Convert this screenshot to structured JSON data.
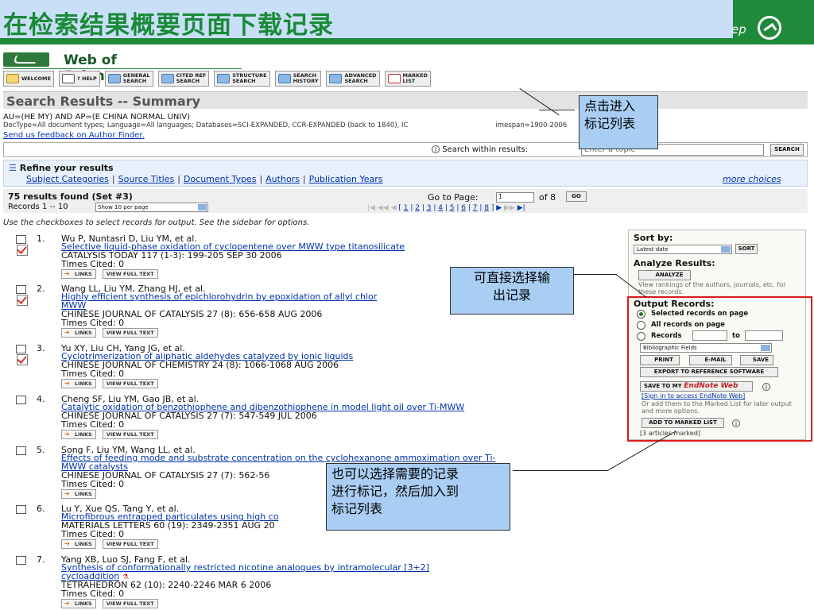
{
  "slide": {
    "title": "在检索结果概要页面下载记录",
    "step_text": "ep"
  },
  "app": {
    "title": "Web of Science",
    "registered": "®"
  },
  "toolbar": [
    {
      "label": "WELCOME",
      "icon": "home-icon"
    },
    {
      "label": "? HELP",
      "icon": "help-icon"
    },
    {
      "label": "GENERAL\nSEARCH",
      "icon": "general-search-icon"
    },
    {
      "label": "CITED REF\nSEARCH",
      "icon": "cited-ref-icon"
    },
    {
      "label": "STRUCTURE\nSEARCH",
      "icon": "structure-icon"
    },
    {
      "label": "SEARCH\nHISTORY",
      "icon": "history-icon"
    },
    {
      "label": "ADVANCED\nSEARCH",
      "icon": "advanced-icon"
    },
    {
      "label": "MARKED\nLIST",
      "icon": "marked-list-icon"
    }
  ],
  "summary": {
    "title": "Search Results -- Summary",
    "query": "AU=(HE MY) AND AP=(E CHINA NORMAL UNIV)",
    "meta": "DocType=All document types; Language=All languages; Databases=SCI-EXPANDED, CCR-EXPANDED (back to 1840), IC",
    "meta_end": "imespan=1900-2006",
    "feedback": "Send us feedback on Author Finder."
  },
  "search": {
    "label": "Search within results:",
    "placeholder": "Enter a topic",
    "button": "SEARCH"
  },
  "refine": {
    "title": "Refine your results",
    "links": [
      "Subject Categories",
      "Source Titles",
      "Document Types",
      "Authors",
      "Publication Years"
    ],
    "more": "more choices"
  },
  "results": {
    "found": "75 results found (Set #3)",
    "records": "Records 1 -- 10",
    "per_page": "Show 10 per page",
    "goto": "Go to Page:",
    "page_value": "1",
    "of_pages": "of 8",
    "go": "GO",
    "pages": [
      "1",
      "2",
      "3",
      "4",
      "5",
      "6",
      "7",
      "8"
    ]
  },
  "instructions": "Use the checkboxes to select records for output. See the sidebar for options.",
  "records": [
    {
      "num": "1.",
      "authors": "Wu P, Nuntasri D, Liu YM, et al.",
      "title": "Selective liquid-phase oxidation of cyclopentene over MWW type titanosilicate",
      "source": "CATALYSIS TODAY 117 (1-3): 199-205 SEP 30 2006",
      "cited": "Times Cited: 0",
      "checked": true,
      "fulltext": true
    },
    {
      "num": "2.",
      "authors": "Wang LL, Liu YM, Zhang HJ, et al.",
      "title": "Highly efficient synthesis of epichlorohydrin by epoxidation of allyl chlor",
      "title_end": "e Ti-",
      "title_line2": "MWW",
      "source": "CHINESE JOURNAL OF CATALYSIS 27 (8): 656-658 AUG 2006",
      "cited": "Times Cited: 0",
      "checked": true,
      "fulltext": true
    },
    {
      "num": "3.",
      "authors": "Yu XY, Liu CH, Yang JG, et al.",
      "title": "Cyclotrimerization of aliphatic aldehydes catalyzed by ionic liquids",
      "source": "CHINESE JOURNAL OF CHEMISTRY 24 (8): 1066-1068 AUG 2006",
      "cited": "Times Cited: 0",
      "checked": true,
      "fulltext": true
    },
    {
      "num": "4.",
      "authors": "Cheng SF, Liu YM, Gao JB, et al.",
      "title": "Catalytic oxidation of benzothiophene and dibenzothiophene in model light oil over Ti-MWW",
      "source": "CHINESE JOURNAL OF CATALYSIS 27 (7): 547-549 JUL 2006",
      "cited": "Times Cited: 0",
      "checked": false,
      "fulltext": true
    },
    {
      "num": "5.",
      "authors": "Song F, Liu YM, Wang LL, et al.",
      "title": "Effects of feeding mode and substrate concentration on the cyclohexanone ammoximation over Ti-",
      "title_line2": "MWW catalysts",
      "source": "CHINESE JOURNAL OF CATALYSIS 27 (7): 562-56",
      "cited": "Times Cited: 0",
      "checked": false,
      "fulltext": false
    },
    {
      "num": "6.",
      "authors": "Lu Y, Xue QS, Tang Y, et al.",
      "title": "Microfibrous entrapped particulates using high co",
      "source": "MATERIALS LETTERS 60 (19): 2349-2351 AUG 20",
      "cited": "Times Cited: 0",
      "checked": false,
      "fulltext": true
    },
    {
      "num": "7.",
      "authors": "Yang XB, Luo SJ, Fang F, et al.",
      "title": "Synthesis of conformationally restricted nicotine analogues by intramolecular [3+2]",
      "title_line2": "cycloaddition",
      "source": "TETRAHEDRON 62 (10): 2240-2246 MAR 6 2006",
      "cited": "Times Cited: 0",
      "checked": false,
      "fulltext": true
    }
  ],
  "buttons": {
    "links": "LINKS",
    "fulltext": "VIEW FULL TEXT"
  },
  "sidebar": {
    "sort_title": "Sort by:",
    "sort_value": "Latest date",
    "sort_btn": "SORT",
    "analyze_title": "Analyze Results:",
    "analyze_btn": "ANALYZE",
    "analyze_desc": "View rankings of the authors, journals, etc. for these records.",
    "output_title": "Output Records:",
    "opt_selected": "Selected records on page",
    "opt_all": "All records on page",
    "opt_records": "Records",
    "opt_to": "to",
    "fields": "Bibliographic Fields",
    "print": "PRINT",
    "email": "E-MAIL",
    "save": "SAVE",
    "export": "EXPORT TO REFERENCE SOFTWARE",
    "save_to": "SAVE TO MY",
    "endnote": "EndNote Web",
    "sign_in": "[Sign in to access EndNote Web]",
    "or_add": "Or add them to the Marked List for later output and more options.",
    "add_marked": "ADD TO MARKED LIST",
    "marked_count": "[3 articles marked]"
  },
  "callouts": {
    "c1": "点击进入\n标记列表",
    "c2": "可直接选择输\n出记录",
    "c3": "也可以选择需要的记录\n进行标记，然后加入到\n标记列表"
  },
  "colors": {
    "accent": "#1f8a3a",
    "link": "#0033aa",
    "callout": "#a9cdf3",
    "highlight": "#d81c1c"
  }
}
